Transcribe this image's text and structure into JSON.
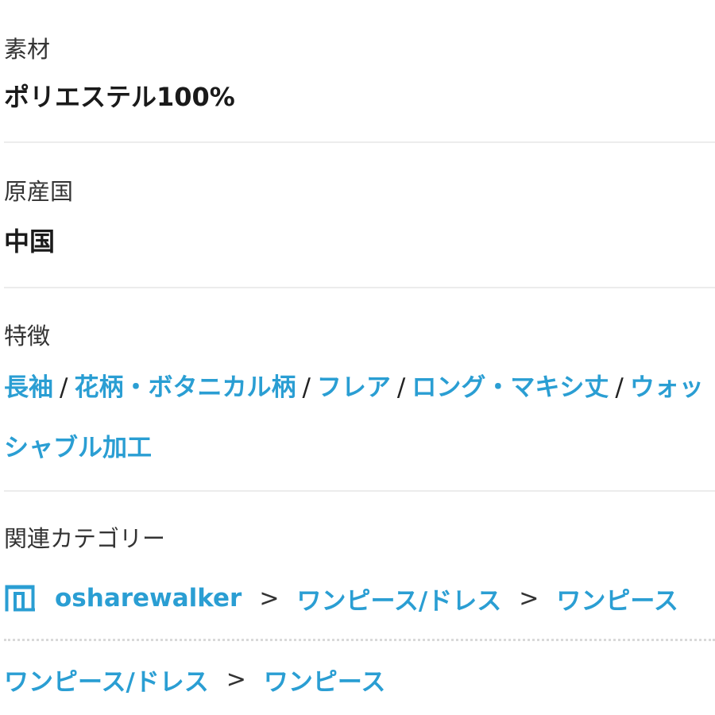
{
  "material": {
    "label": "素材",
    "value": "ポリエステル100%"
  },
  "origin": {
    "label": "原産国",
    "value": "中国"
  },
  "features": {
    "label": "特徴",
    "separator": "/",
    "items": [
      "長袖",
      "花柄・ボタニカル柄",
      "フレア",
      "ロング・マキシ丈",
      "ウォッシャブル加工"
    ]
  },
  "related_categories": {
    "label": "関連カテゴリー",
    "separator": ">",
    "icon": "store-icon",
    "accent_color": "#2a9ed3",
    "paths": [
      [
        "osharewalker",
        "ワンピース/ドレス",
        "ワンピース"
      ],
      [
        "ワンピース/ドレス",
        "ワンピース"
      ]
    ]
  }
}
